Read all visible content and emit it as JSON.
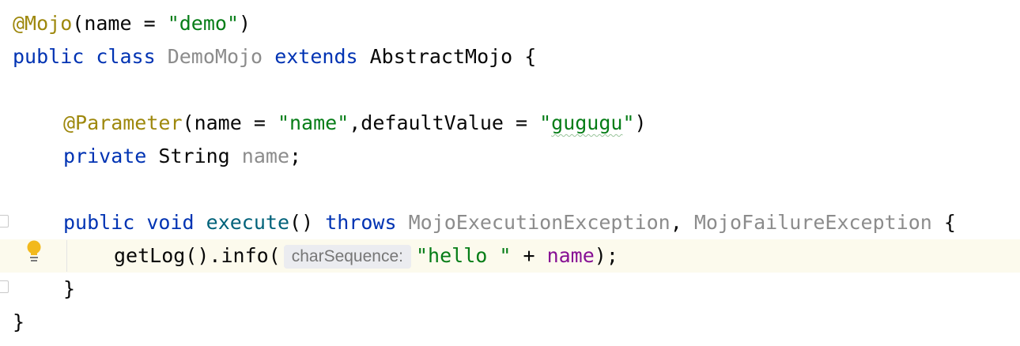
{
  "editor": {
    "line1": {
      "annotation": "@Mojo",
      "p1": "(name = ",
      "s1": "\"demo\"",
      "p2": ")"
    },
    "line2": {
      "kw_public": "public",
      "kw_class": "class",
      "classname": "DemoMojo",
      "kw_extends": "extends",
      "superclass": "AbstractMojo",
      "brace": "{"
    },
    "line4": {
      "annotation": "@Parameter",
      "p1": "(name = ",
      "s1": "\"name\"",
      "p2": ",defaultValue = ",
      "s2_open": "\"",
      "s2_body": "gugugu",
      "s2_close": "\"",
      "p3": ")"
    },
    "line5": {
      "kw_private": "private",
      "type": "String",
      "field": "name",
      "semi": ";"
    },
    "line7": {
      "kw_public": "public",
      "kw_void": "void",
      "method": "execute",
      "parens": "()",
      "kw_throws": "throws",
      "ex1": "MojoExecutionException",
      "comma": ",",
      "ex2": "MojoFailureException",
      "brace": "{"
    },
    "line8": {
      "call": "getLog().info(",
      "hint": "charSequence:",
      "s1": "\"hello \"",
      "op": " + ",
      "field": "name",
      "end": ");"
    },
    "line9": {
      "brace": "}"
    },
    "line10": {
      "brace": "}"
    }
  },
  "colors": {
    "annotation": "#9e880d",
    "keyword": "#0033b3",
    "string": "#067d17",
    "unused": "#8c8c8c",
    "method": "#00627a",
    "field": "#871094",
    "current_line": "#fcfaed",
    "bulb": "#f2b91c"
  },
  "icons": {
    "gutter": "lightbulb-icon",
    "fold": "fold-marker-icon"
  }
}
